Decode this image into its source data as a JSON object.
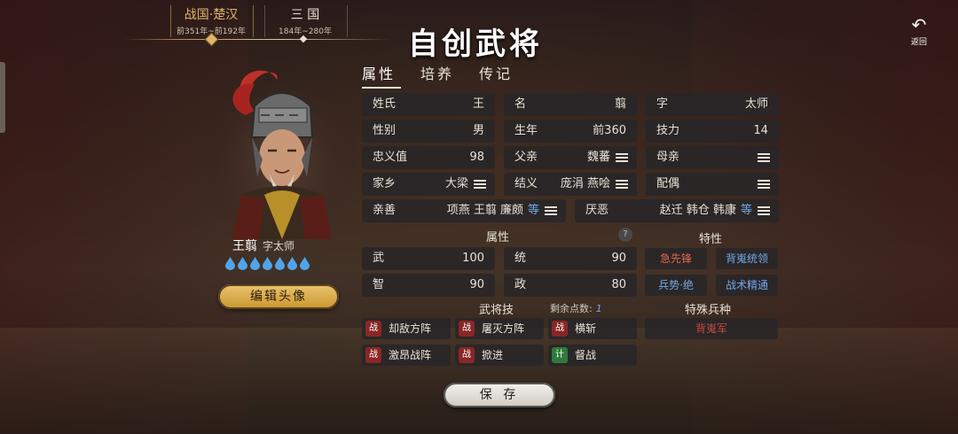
{
  "timeline": {
    "eras": [
      {
        "name": "战国·楚汉",
        "range": "前351年~前192年"
      },
      {
        "name": "三 国",
        "range": "184年~280年"
      }
    ]
  },
  "title": "自创武将",
  "back_label": "返回",
  "tabs": [
    "属性",
    "培养",
    "传记"
  ],
  "hero": {
    "name": "王翦",
    "courtesy": "字太师",
    "edit_label": "编辑头像",
    "drop_count": 7
  },
  "fields": {
    "surname": {
      "key": "姓氏",
      "value": "王"
    },
    "given": {
      "key": "名",
      "value": "翦"
    },
    "style": {
      "key": "字",
      "value": "太师"
    },
    "gender": {
      "key": "性别",
      "value": "男"
    },
    "birth": {
      "key": "生年",
      "value": "前360"
    },
    "skill_power": {
      "key": "技力",
      "value": "14"
    },
    "loyalty": {
      "key": "忠义值",
      "value": "98"
    },
    "father": {
      "key": "父亲",
      "value": "魏蕃"
    },
    "mother": {
      "key": "母亲",
      "value": ""
    },
    "hometown": {
      "key": "家乡",
      "value": "大梁"
    },
    "sworn": {
      "key": "结义",
      "value": "庞涓 燕哙"
    },
    "spouse": {
      "key": "配偶",
      "value": ""
    },
    "likes": {
      "key": "亲善",
      "value": "项燕 王翦 廉颇",
      "more": "等"
    },
    "dislikes": {
      "key": "厌恶",
      "value": "赵迁 韩仓 韩康",
      "more": "等"
    }
  },
  "attributes": {
    "label": "属性",
    "items": [
      {
        "key": "武",
        "value": "100"
      },
      {
        "key": "统",
        "value": "90"
      },
      {
        "key": "智",
        "value": "90"
      },
      {
        "key": "政",
        "value": "80"
      }
    ]
  },
  "traits": {
    "label": "特性",
    "items": [
      {
        "name": "急先锋",
        "color": "red"
      },
      {
        "name": "背嵬统领",
        "color": "blue"
      },
      {
        "name": "兵势·绝",
        "color": "blue"
      },
      {
        "name": "战术精通",
        "color": "blue"
      }
    ]
  },
  "skills": {
    "label": "武将技",
    "remain_label": "剩余点数:",
    "remain_value": "1",
    "items": [
      {
        "type": "战",
        "name": "却敌方阵"
      },
      {
        "type": "战",
        "name": "屠灭方阵"
      },
      {
        "type": "战",
        "name": "横斩"
      },
      {
        "type": "战",
        "name": "激昂战阵"
      },
      {
        "type": "战",
        "name": "掀进"
      },
      {
        "type": "计",
        "name": "督战"
      }
    ]
  },
  "special_troop": {
    "label": "特殊兵种",
    "value": "背嵬军"
  },
  "save_label": "保 存",
  "colors": {
    "accent_gold": "#e0b66a",
    "trait_red": "#e06a4a",
    "trait_blue": "#6fa6e8",
    "battle_badge": "#8a2626",
    "plan_badge": "#2f7a3a"
  }
}
